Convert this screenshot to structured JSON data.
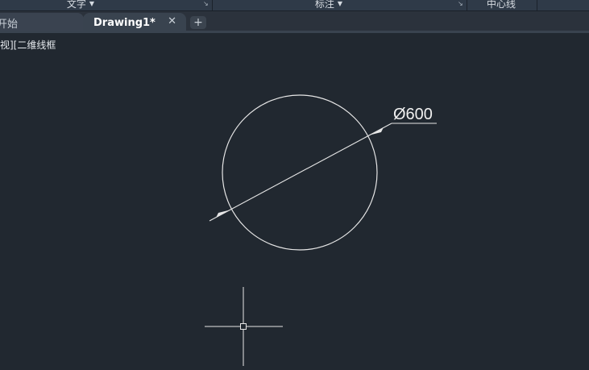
{
  "ribbon": {
    "panels": [
      {
        "label": "文字",
        "launcher": "↘"
      },
      {
        "label": "标注",
        "launcher": "↘"
      },
      {
        "label": "中心线"
      }
    ]
  },
  "tabs": {
    "start_label": "开始",
    "drawing_label": "Drawing1*",
    "close_glyph": "✕",
    "add_glyph": "+"
  },
  "viewport": {
    "controls_label": "视][二维线框"
  },
  "drawing": {
    "dimension_text": "Ø600",
    "line_color": "#e6e6e6",
    "background": "#212830"
  }
}
